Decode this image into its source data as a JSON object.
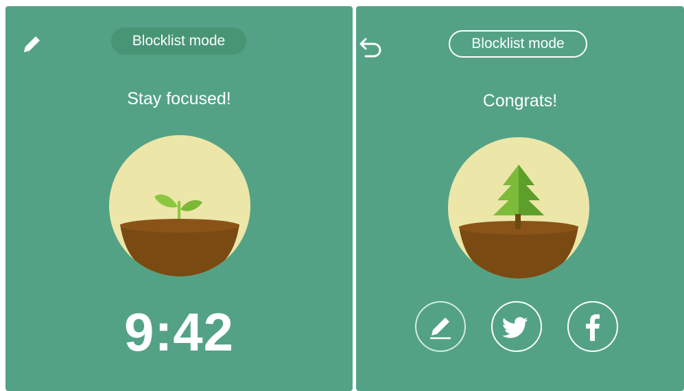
{
  "left_panel": {
    "mode_label": "Blocklist mode",
    "title": "Stay focused!",
    "timer": "9:42",
    "icons": {
      "edit": "pencil-icon",
      "plant": "sprout-icon"
    }
  },
  "right_panel": {
    "mode_label": "Blocklist mode",
    "title": "Congrats!",
    "icons": {
      "back": "back-arrow-icon",
      "plant": "tree-icon"
    },
    "share_buttons": [
      "edit-share",
      "twitter",
      "facebook"
    ]
  },
  "colors": {
    "background": "#53a286",
    "pill_fill": "#489576",
    "circle": "#ece6a9",
    "soil": "#7a4a13",
    "soil_top": "#8a5419",
    "leaf": "#8cc63f",
    "white": "#ffffff"
  }
}
